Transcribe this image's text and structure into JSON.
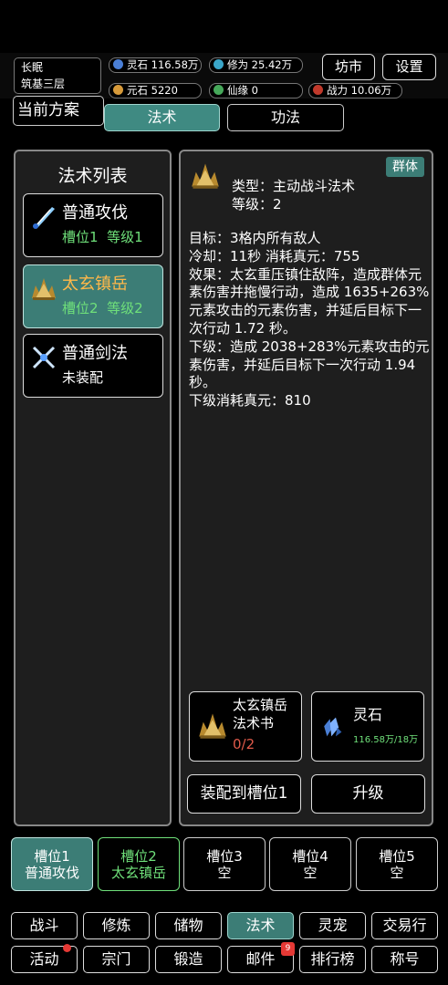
{
  "character": {
    "name": "长眠",
    "realm": "筑基三层"
  },
  "resources": {
    "spirit_stone": {
      "label": "灵石",
      "value": "116.58万",
      "icon": "spirit-stone-icon"
    },
    "cultivation": {
      "label": "修为",
      "value": "25.42万",
      "icon": "cultivation-icon"
    },
    "yuanshi": {
      "label": "元石",
      "value": "5220",
      "icon": "yuanshi-icon"
    },
    "fate": {
      "label": "仙缘",
      "value": "0",
      "icon": "fate-icon"
    },
    "power": {
      "label": "战力",
      "value": "10.06万",
      "icon": "power-icon"
    }
  },
  "header": {
    "market": "坊市",
    "settings": "设置",
    "plan": "当前方案"
  },
  "tabs": [
    {
      "label": "法术"
    },
    {
      "label": "功法"
    }
  ],
  "spell_list": {
    "title": "法术列表",
    "items": [
      {
        "name": "普通攻伐",
        "slot": "槽位1",
        "level": "等级1",
        "icon": "blade-slash-icon"
      },
      {
        "name": "太玄镇岳",
        "slot": "槽位2",
        "level": "等级2",
        "icon": "mountain-crown-icon"
      },
      {
        "name": "普通剑法",
        "status": "未装配",
        "icon": "crossed-swords-icon"
      }
    ]
  },
  "detail": {
    "badge": "群体",
    "type": "类型：主动战斗法术",
    "level": "等级：2",
    "description": "目标：3格内所有敌人\n冷却：11秒  消耗真元：755\n效果：太玄重压镇住敌阵，造成群体元素伤害并拖慢行动，造成 1635+263%元素攻击的元素伤害，并延后目标下一次行动 1.72 秒。\n下级：造成 2038+283%元素攻击的元素伤害，并延后目标下一次行动 1.94 秒。\n下级消耗真元：810",
    "book": {
      "name": "太玄镇岳\n法术书",
      "count": "0/2",
      "icon": "mountain-crown-icon"
    },
    "stone": {
      "name": "灵石",
      "amount": "116.58万/18万",
      "icon": "spirit-crystal-icon"
    },
    "equip_button": "装配到槽位1",
    "upgrade_button": "升级"
  },
  "slots": [
    {
      "label": "槽位1",
      "value": "普通攻伐"
    },
    {
      "label": "槽位2",
      "value": "太玄镇岳"
    },
    {
      "label": "槽位3",
      "value": "空"
    },
    {
      "label": "槽位4",
      "value": "空"
    },
    {
      "label": "槽位5",
      "value": "空"
    }
  ],
  "nav": [
    {
      "label": "战斗"
    },
    {
      "label": "修炼"
    },
    {
      "label": "储物"
    },
    {
      "label": "法术"
    },
    {
      "label": "灵宠"
    },
    {
      "label": "交易行"
    },
    {
      "label": "活动"
    },
    {
      "label": "宗门"
    },
    {
      "label": "锻造"
    },
    {
      "label": "邮件",
      "badge": "9"
    },
    {
      "label": "排行榜"
    },
    {
      "label": "称号"
    }
  ],
  "colors": {
    "accent": "#3c7d76",
    "green_text": "#6fe07a",
    "gold_text": "#ffb84a",
    "red": "#e53935"
  }
}
